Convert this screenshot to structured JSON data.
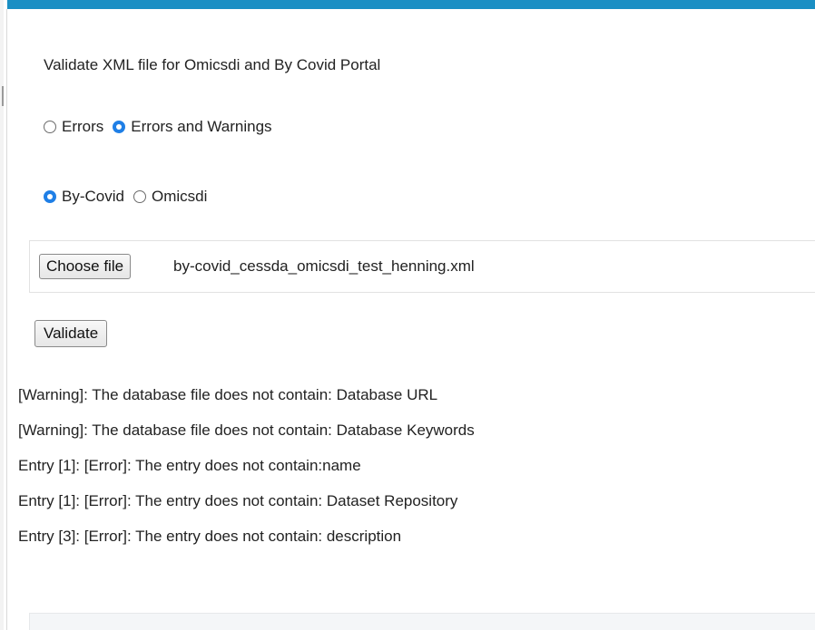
{
  "form": {
    "title": "Validate XML file for Omicsdi and By Covid Portal",
    "severity_options": [
      {
        "label": "Errors",
        "checked": false
      },
      {
        "label": "Errors and Warnings",
        "checked": true
      }
    ],
    "portal_options": [
      {
        "label": "By-Covid",
        "checked": true
      },
      {
        "label": "Omicsdi",
        "checked": false
      }
    ],
    "file_input": {
      "button_label": "Choose file",
      "file_name": "by-covid_cessda_omicsdi_test_henning.xml"
    },
    "validate_label": "Validate"
  },
  "results": [
    "[Warning]: The database file does not contain: Database URL",
    "[Warning]: The database file does not contain: Database Keywords",
    "Entry [1]: [Error]: The entry does not contain:name",
    "Entry [1]: [Error]: The entry does not contain: Dataset Repository",
    "Entry [3]: [Error]: The entry does not contain: description"
  ],
  "colors": {
    "header_accent": "#1a8fc4",
    "radio_selected": "#1f7fe6"
  }
}
